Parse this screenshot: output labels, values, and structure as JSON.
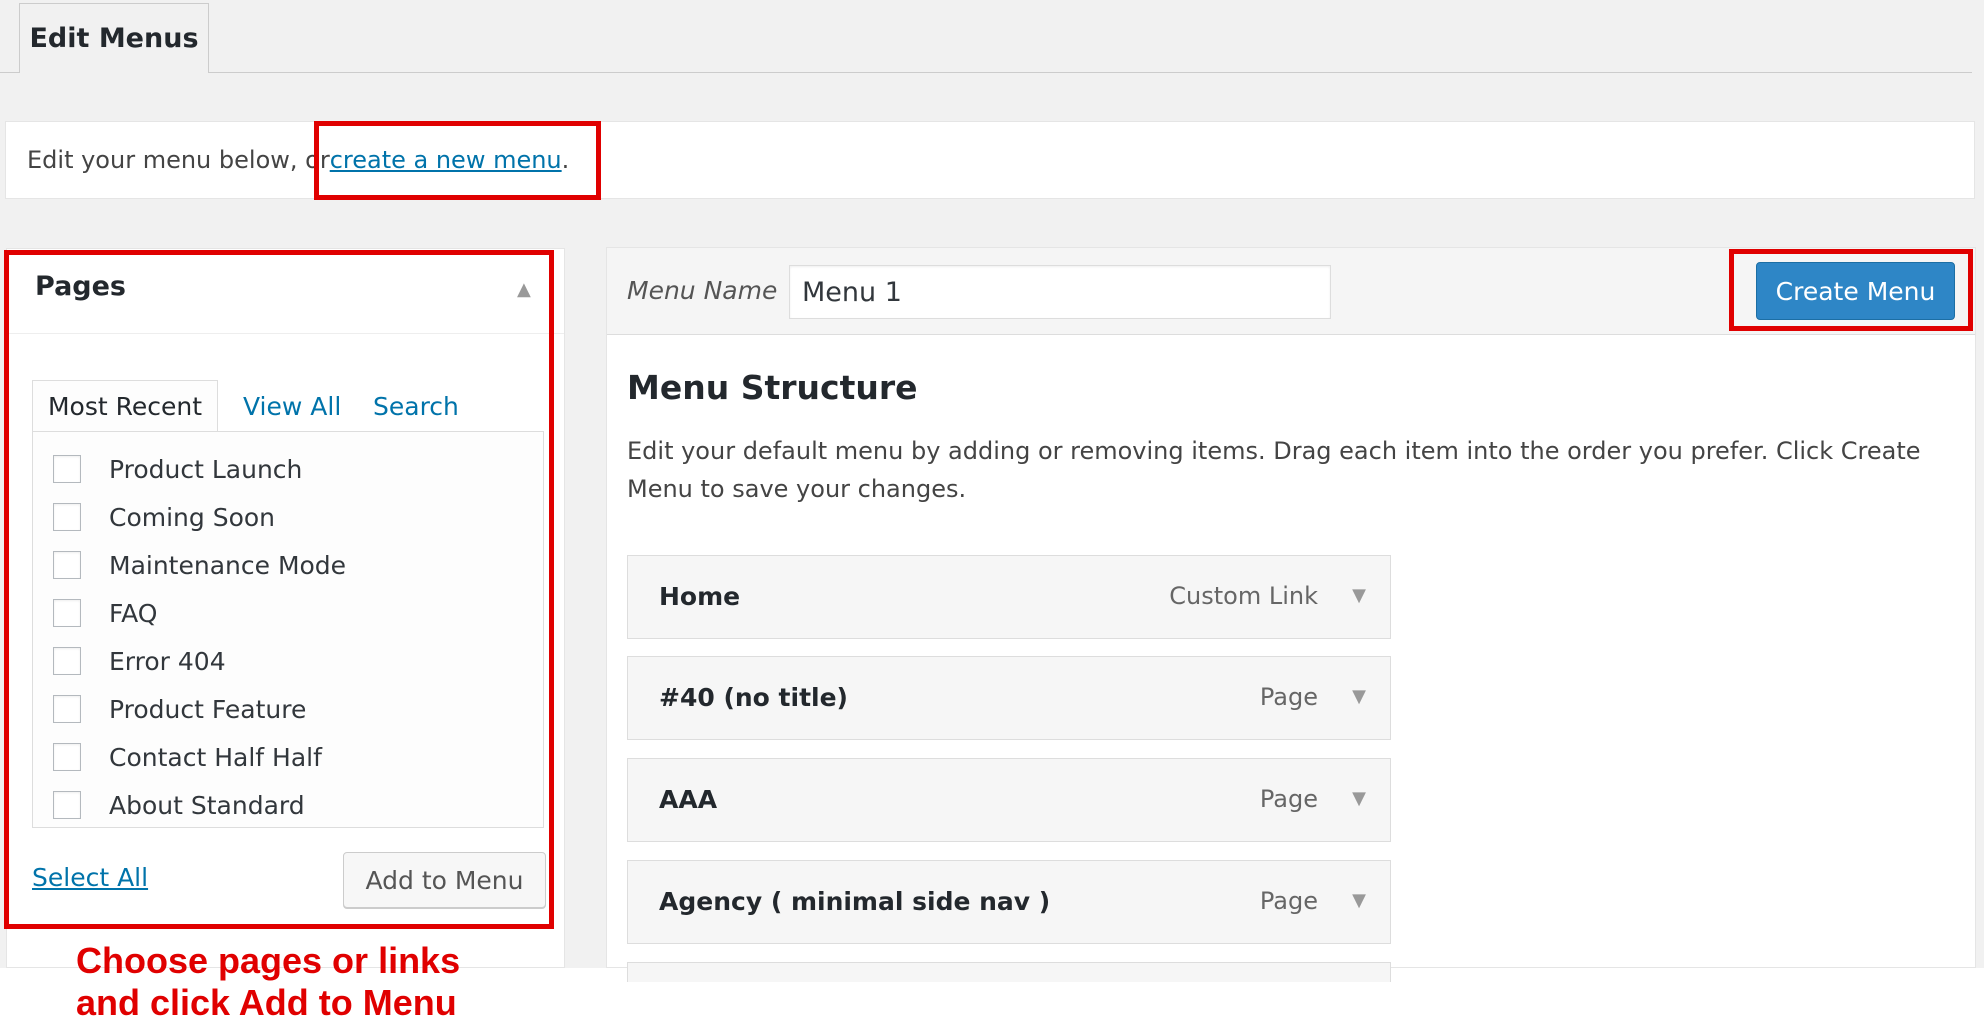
{
  "header": {
    "tab_label": "Edit Menus"
  },
  "notice": {
    "text_before": "Edit your menu below, or ",
    "link_text": "create a new menu",
    "text_after": "."
  },
  "sidebar": {
    "title": "Pages",
    "tabs": [
      "Most Recent",
      "View All",
      "Search"
    ],
    "pages": [
      "Product Launch",
      "Coming Soon",
      "Maintenance Mode",
      "FAQ",
      "Error 404",
      "Product Feature",
      "Contact Half Half",
      "About Standard"
    ],
    "select_all_label": "Select All",
    "add_button_label": "Add to Menu"
  },
  "main": {
    "menu_name_label": "Menu Name",
    "menu_name_value": "Menu 1",
    "create_button_label": "Create Menu",
    "structure_title": "Menu Structure",
    "structure_description": "Edit your default menu by adding or removing items. Drag each item into the order you prefer. Click Create Menu to save your changes.",
    "items": [
      {
        "title": "Home",
        "type": "Custom Link"
      },
      {
        "title": "#40 (no title)",
        "type": "Page"
      },
      {
        "title": "AAA",
        "type": "Page"
      },
      {
        "title": "Agency ( minimal side nav )",
        "type": "Page"
      }
    ]
  },
  "annotation": {
    "line1": "Choose pages or links",
    "line2": "and click Add to Menu"
  },
  "colors": {
    "highlight": "#e00000",
    "primary_button": "#2e86c6",
    "link": "#0073aa"
  },
  "icons": {
    "collapse": "triangle-up-icon",
    "expand": "triangle-down-icon"
  }
}
